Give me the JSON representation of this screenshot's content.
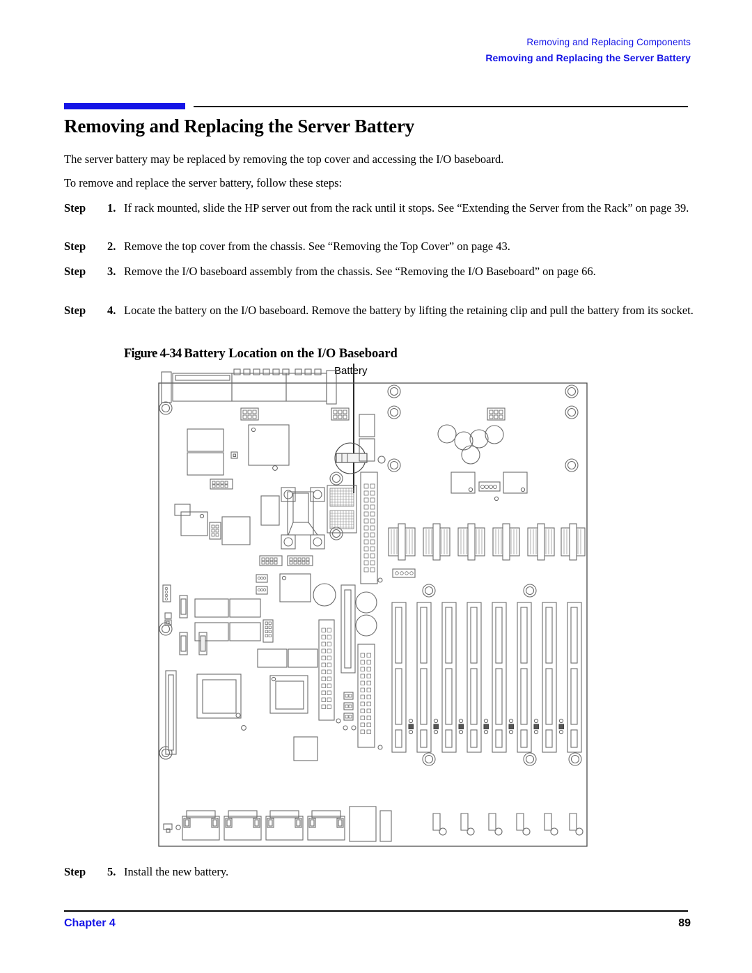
{
  "header": {
    "line1": "Removing and Replacing Components",
    "line2": "Removing and Replacing the Server Battery",
    "accent_color": "#1414e6"
  },
  "title": "Removing and Replacing the Server Battery",
  "intro": {
    "paragraph1": "The server battery may be replaced by removing the top cover and accessing the I/O baseboard.",
    "paragraph2": "To remove and replace the server battery, follow these steps:"
  },
  "steps": [
    {
      "label": "Step",
      "number": "1.",
      "text": "If rack mounted, slide the HP server out from the rack until it stops. See “Extending the Server from the Rack” on page 39."
    },
    {
      "label": "Step",
      "number": "2.",
      "text": "Remove the top cover from the chassis. See “Removing the Top Cover” on page 43."
    },
    {
      "label": "Step",
      "number": "3.",
      "text": "Remove the I/O baseboard assembly from the chassis. See “Removing the I/O Baseboard” on page 66."
    },
    {
      "label": "Step",
      "number": "4.",
      "text": "Locate the battery on the I/O baseboard. Remove the battery by lifting the retaining clip and pull the battery from its socket."
    },
    {
      "label": "Step",
      "number": "5.",
      "text": "Install the new battery."
    }
  ],
  "figure": {
    "caption_number": "Figure 4-34",
    "caption_text": "Battery Location on the I/O Baseboard",
    "callout_label": "Battery"
  },
  "footer": {
    "chapter": "Chapter 4",
    "page_number": "89",
    "chapter_color": "#1414e6"
  }
}
